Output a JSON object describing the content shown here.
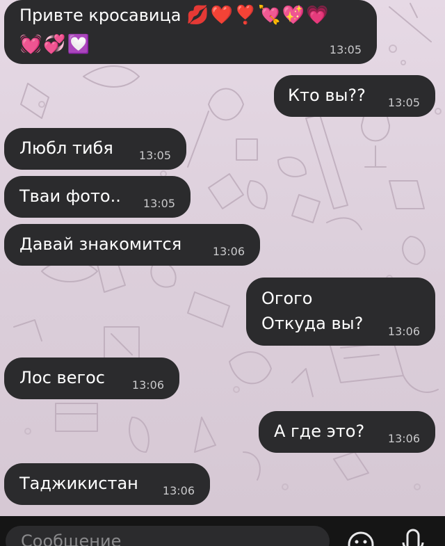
{
  "chat": {
    "messages": [
      {
        "id": "m1",
        "side": "in",
        "text": "Привте кросавица",
        "emoji_line1": "💋❤️❣️💘💖💗",
        "emoji_line2": "💓💞💟",
        "time": "13:05"
      },
      {
        "id": "m2",
        "side": "out",
        "text": "Кто вы??",
        "time": "13:05"
      },
      {
        "id": "m3",
        "side": "in",
        "text": "Любл тибя",
        "time": "13:05"
      },
      {
        "id": "m4",
        "side": "in",
        "text": "Тваи фото..",
        "time": "13:05"
      },
      {
        "id": "m5",
        "side": "in",
        "text": "Давай знакомится",
        "time": "13:06"
      },
      {
        "id": "m6",
        "side": "out",
        "text": "Огого\nОткуда вы?",
        "time": "13:06"
      },
      {
        "id": "m7",
        "side": "in",
        "text": "Лос вегос",
        "time": "13:06"
      },
      {
        "id": "m8",
        "side": "out",
        "text": "А где это?",
        "time": "13:06"
      },
      {
        "id": "m9",
        "side": "in",
        "text": "Таджикистан",
        "time": "13:06"
      }
    ]
  },
  "composer": {
    "placeholder": "Сообщение",
    "emoji_icon": "emoji-icon",
    "mic_icon": "microphone-icon"
  },
  "colors": {
    "bubble": "#2b2b2d",
    "wallpaper": "#ddd0dc",
    "bar": "#151515"
  }
}
